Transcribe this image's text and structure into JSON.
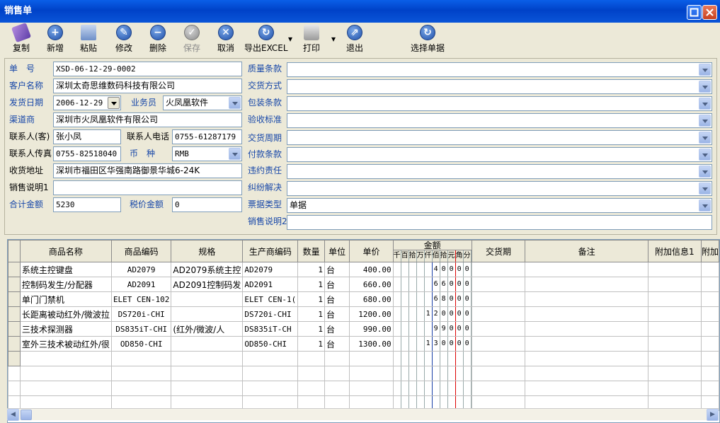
{
  "window": {
    "title": "销售单"
  },
  "toolbar": {
    "copy": "复制",
    "new": "新增",
    "paste": "粘贴",
    "edit": "修改",
    "delete": "删除",
    "save": "保存",
    "cancel": "取消",
    "export": "导出EXCEL",
    "print": "打印",
    "exit": "退出",
    "select": "选择单据"
  },
  "form": {
    "order_no_label": "单　号",
    "order_no": "XSD-06-12-29-0002",
    "customer_label": "客户名称",
    "customer": "深圳太奇思维数码科技有限公司",
    "ship_date_label": "发货日期",
    "ship_date": "2006-12-29",
    "salesman_label": "业务员",
    "salesman": "火凤凰软件",
    "channel_label": "渠道商",
    "channel": "深圳市火凤凰软件有限公司",
    "contact_label": "联系人(客)",
    "contact": "张小凤",
    "phone_label": "联系人电话",
    "phone": "0755-61287179",
    "fax_label": "联系人传真",
    "fax": "0755-82518040",
    "currency_label": "币　种",
    "currency": "RMB",
    "address_label": "收货地址",
    "address": "深圳市福田区华强南路御景华城6-24K",
    "note1_label": "销售说明1",
    "note1": "",
    "total_label": "合计金额",
    "total": "5230",
    "tax_label": "税价金额",
    "tax": "0",
    "quality_label": "质量条款",
    "delivery_label": "交货方式",
    "packing_label": "包装条款",
    "acceptance_label": "验收标准",
    "cycle_label": "交货周期",
    "payment_label": "付款条款",
    "liability_label": "违约责任",
    "dispute_label": "纠纷解决",
    "invoice_label": "票据类型",
    "invoice": "单据",
    "note2_label": "销售说明2"
  },
  "grid": {
    "headers": {
      "name": "商品名称",
      "code": "商品编码",
      "spec": "规格",
      "mfr": "生产商编码",
      "qty": "数量",
      "unit": "单位",
      "price": "单价",
      "amount": "金额",
      "delivery": "交货期",
      "remark": "备注",
      "extra1": "附加信息1",
      "extra2": "附加"
    },
    "amount_digits": [
      "千",
      "百",
      "拾",
      "万",
      "仟",
      "佰",
      "拾",
      "元",
      "角",
      "分"
    ],
    "rows": [
      {
        "name": "系统主控键盘",
        "code": "AD2079",
        "spec": "AD2079系统主控",
        "mfr": "AD2079",
        "qty": "1",
        "unit": "台",
        "price": "400.00",
        "digits": [
          "",
          "",
          "",
          "",
          "",
          "4",
          "0",
          "0",
          "0",
          "0"
        ]
      },
      {
        "name": "控制码发生/分配器",
        "code": "AD2091",
        "spec": "AD2091控制码发",
        "mfr": "AD2091",
        "qty": "1",
        "unit": "台",
        "price": "660.00",
        "digits": [
          "",
          "",
          "",
          "",
          "",
          "6",
          "6",
          "0",
          "0",
          "0"
        ]
      },
      {
        "name": "单门门禁机",
        "code": "ELET CEN-102",
        "spec": "",
        "mfr": "ELET CEN-1(",
        "qty": "1",
        "unit": "台",
        "price": "680.00",
        "digits": [
          "",
          "",
          "",
          "",
          "",
          "6",
          "8",
          "0",
          "0",
          "0"
        ]
      },
      {
        "name": "长距离被动红外/微波拉",
        "code": "DS720i-CHI",
        "spec": "",
        "mfr": "DS720i-CHI",
        "qty": "1",
        "unit": "台",
        "price": "1200.00",
        "digits": [
          "",
          "",
          "",
          "",
          "1",
          "2",
          "0",
          "0",
          "0",
          "0"
        ]
      },
      {
        "name": "三技术探测器",
        "code": "DS835iT-CHI",
        "spec": "(红外/微波/人",
        "mfr": "DS835iT-CH",
        "qty": "1",
        "unit": "台",
        "price": "990.00",
        "digits": [
          "",
          "",
          "",
          "",
          "",
          "9",
          "9",
          "0",
          "0",
          "0"
        ]
      },
      {
        "name": "室外三技术被动红外/很",
        "code": "OD850-CHI",
        "spec": "",
        "mfr": "OD850-CHI",
        "qty": "1",
        "unit": "台",
        "price": "1300.00",
        "digits": [
          "",
          "",
          "",
          "",
          "1",
          "3",
          "0",
          "0",
          "0",
          "0"
        ]
      }
    ]
  }
}
